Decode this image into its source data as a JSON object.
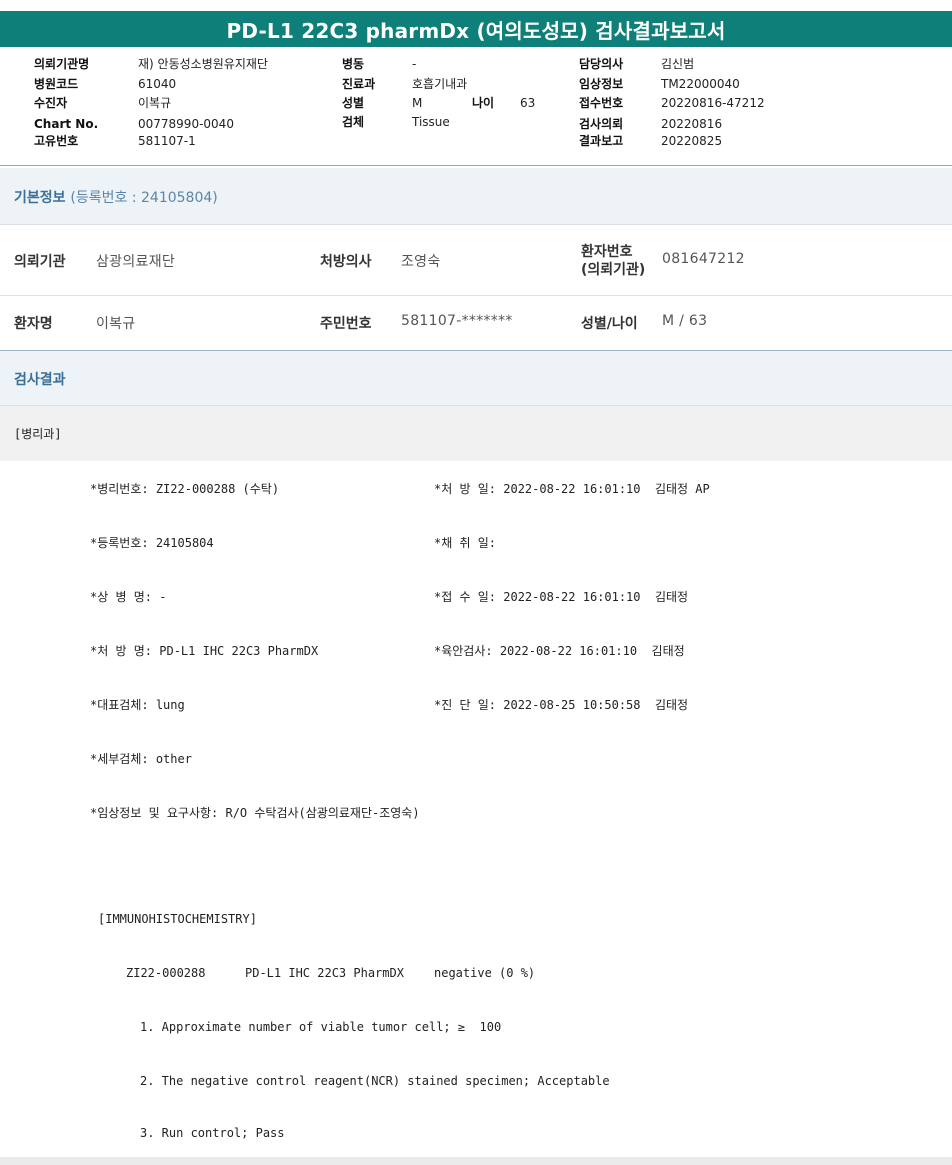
{
  "title": "PD-L1 22C3 pharmDx (여의도성모) 검사결과보고서",
  "header": {
    "col1": [
      {
        "label": "의뢰기관명",
        "value": "재) 안동성소병원유지재단"
      },
      {
        "label": "병원코드",
        "value": "61040"
      },
      {
        "label": "수진자",
        "value": "이복규"
      },
      {
        "label": "Chart No.",
        "value": "00778990-0040"
      },
      {
        "label": "고유번호",
        "value": "581107-1"
      }
    ],
    "col2": [
      {
        "label": "병동",
        "value": "-"
      },
      {
        "label": "진료과",
        "value": "호흡기내과"
      },
      {
        "label": "성별",
        "value": "M"
      },
      {
        "label": "검체",
        "value": "Tissue"
      }
    ],
    "age": {
      "label": "나이",
      "value": "63"
    },
    "col3": [
      {
        "label": "담당의사",
        "value": "김신범"
      },
      {
        "label": "임상정보",
        "value": "TM22000040"
      },
      {
        "label": "접수번호",
        "value": "20220816-47212"
      },
      {
        "label": "검사의뢰",
        "value": "20220816"
      },
      {
        "label": "결과보고",
        "value": "20220825"
      }
    ]
  },
  "basic_info": {
    "title": "기본정보",
    "subtitle": "(등록번호 : 24105804)",
    "row1": {
      "inst_label": "의뢰기관",
      "inst_value": "삼광의료재단",
      "doctor_label": "처방의사",
      "doctor_value": "조영숙",
      "patno_label_1": "환자번호",
      "patno_label_2": "(의뢰기관)",
      "patno_value": "081647212"
    },
    "row2": {
      "name_label": "환자명",
      "name_value": "이복규",
      "rrn_label": "주민번호",
      "rrn_value": "581107-*******",
      "sexage_label": "성별/나이",
      "sexage_value": "M / 63"
    }
  },
  "results": {
    "title": "검사결과",
    "dept": "[병리과]",
    "lines_left": [
      "*병리번호: ZI22-000288 (수탁)",
      "*등록번호: 24105804",
      "*상 병 명: -",
      "*처 방 명: PD-L1 IHC 22C3 PharmDX",
      "*대표검체: lung",
      "*세부검체: other",
      "*임상정보 및 요구사항: R/O 수탁검사(삼광의료재단-조영숙)"
    ],
    "lines_right": [
      "*처 방 일: 2022-08-22 16:01:10  김태정 AP",
      "*채 취 일:",
      "*접 수 일: 2022-08-22 16:01:10  김태정",
      "*육안검사: 2022-08-22 16:01:10  김태정",
      "*진 단 일: 2022-08-25 10:50:58  김태정"
    ],
    "ihc_header": "[IMMUNOHISTOCHEMISTRY]",
    "ihc_id": "ZI22-000288",
    "ihc_test": "PD-L1 IHC 22C3 PharmDX",
    "ihc_result": "negative (0 %)",
    "items": [
      "1. Approximate number of viable tumor cell; ≥  100",
      "2. The negative control reagent(NCR) stained specimen; Acceptable",
      "3. Run control; Pass"
    ]
  }
}
